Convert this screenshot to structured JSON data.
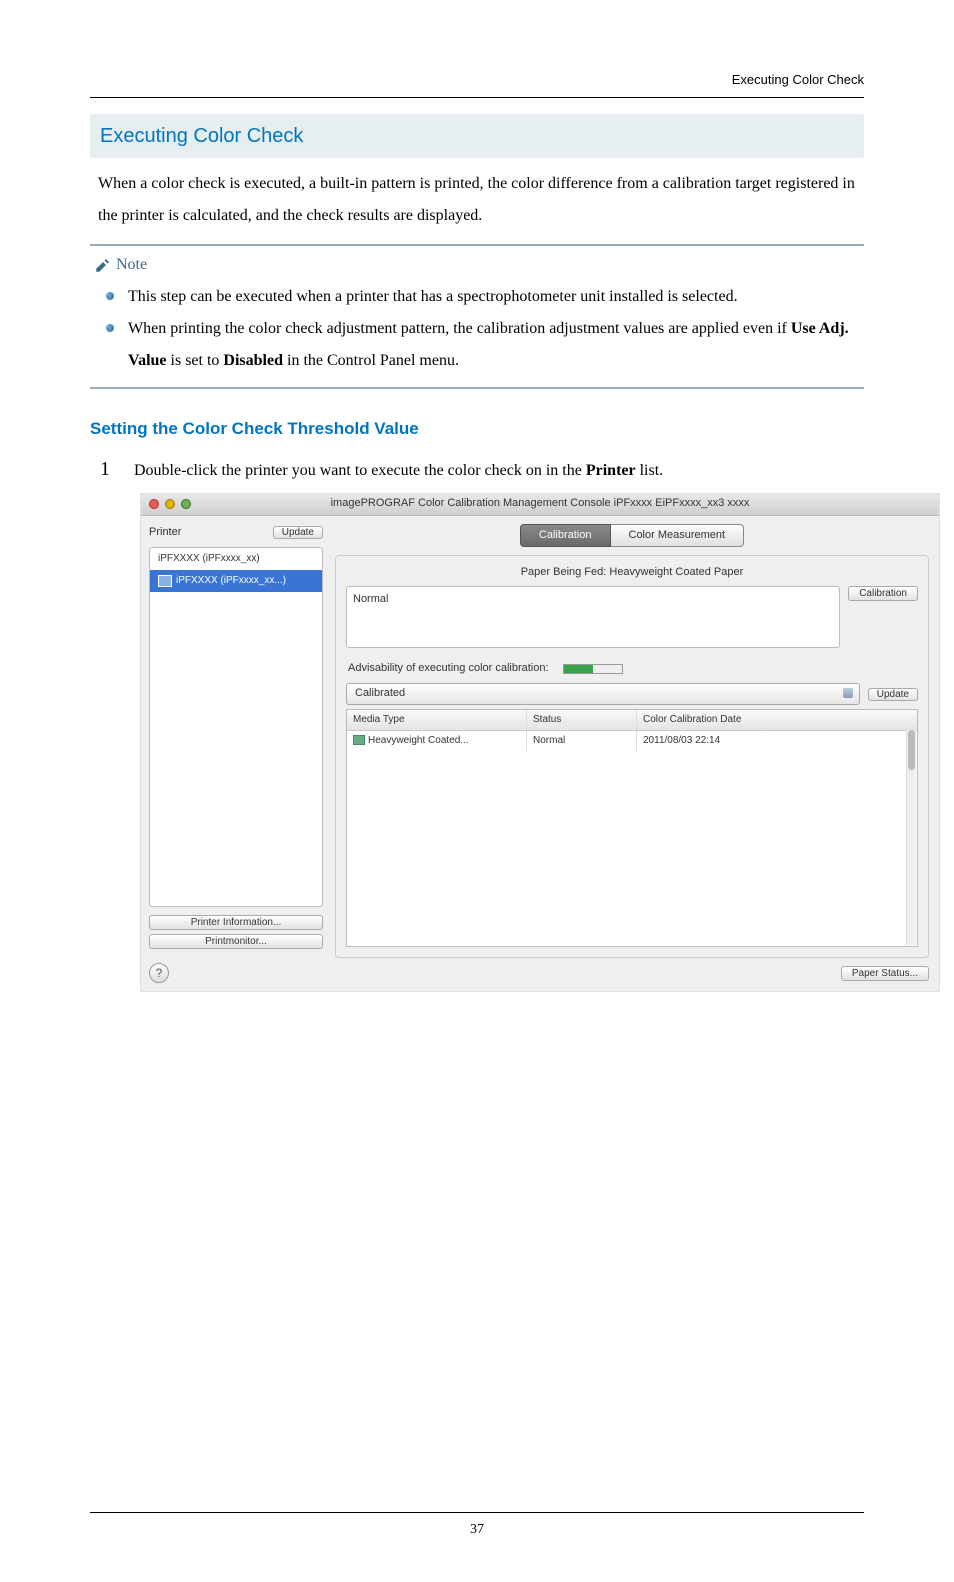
{
  "header_right": "Executing Color Check",
  "h2": "Executing Color Check",
  "intro": "When a color check is executed, a built-in pattern is printed, the color difference from a calibration target registered in the printer is calculated, and the check results are displayed.",
  "note_label": "Note",
  "notes": {
    "n1": "This step can be executed when a printer that has a spectrophotometer unit installed is selected.",
    "n2_a": "When printing the color check adjustment pattern, the calibration adjustment values are applied even if ",
    "n2_b": "Use Adj. Value",
    "n2_c": " is set to ",
    "n2_d": "Disabled",
    "n2_e": " in the Control Panel menu."
  },
  "h3": "Setting the Color Check Threshold Value",
  "step1_num": "1",
  "step1_a": "Double-click the printer you want to execute the color check on in the ",
  "step1_b": "Printer",
  "step1_c": " list.",
  "app": {
    "title": "imagePROGRAF Color Calibration Management Console iPFxxxx EiPFxxxx_xx3 xxxx",
    "sidebar": {
      "label": "Printer",
      "update": "Update",
      "items": {
        "i0": "iPFXXXX (iPFxxxx_xx)",
        "i1": "iPFXXXX (iPFxxxx_xx...)"
      },
      "printer_info": "Printer Information...",
      "printmonitor": "Printmonitor...",
      "help": "?"
    },
    "tabs": {
      "calibration": "Calibration",
      "color_measurement": "Color Measurement"
    },
    "panel": {
      "paper_line": "Paper Being Fed: Heavyweight Coated Paper",
      "status": "Normal",
      "calibrate_btn": "Calibration",
      "adv_label": "Advisability of executing color calibration:",
      "dropdown": "Calibrated",
      "update_btn": "Update",
      "cols": {
        "c1": "Media Type",
        "c2": "Status",
        "c3": "Color Calibration Date"
      },
      "row": {
        "c1": "Heavyweight Coated...",
        "c2": "Normal",
        "c3": "2011/08/03 22:14"
      },
      "paper_status_btn": "Paper Status..."
    }
  },
  "page_number": "37"
}
